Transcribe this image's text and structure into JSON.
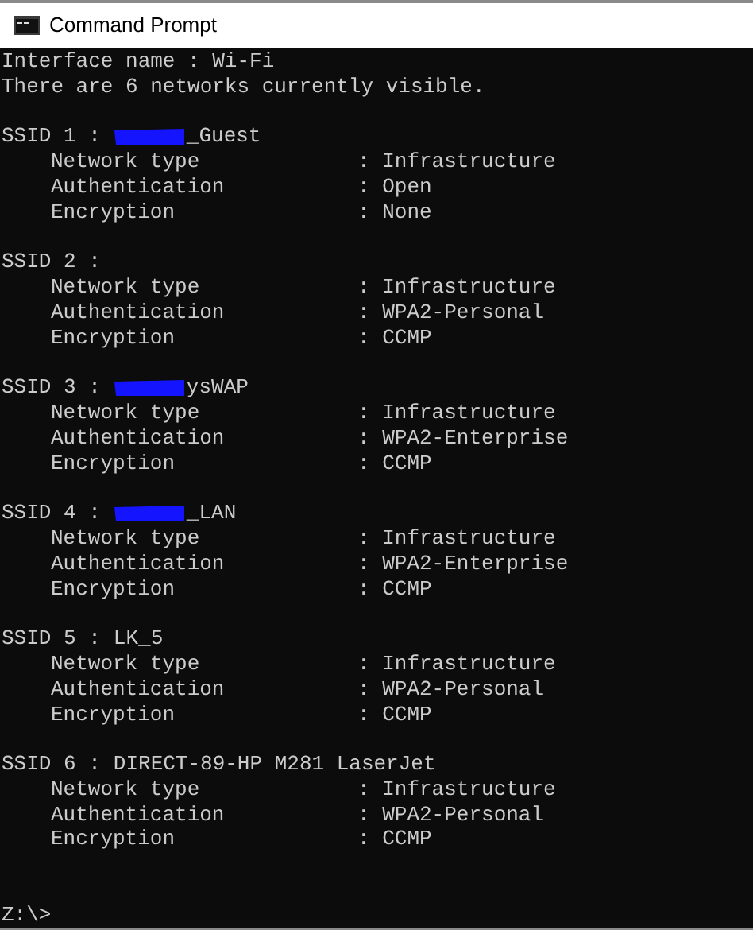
{
  "window": {
    "title": "Command Prompt"
  },
  "header": [
    "Interface name : Wi-Fi",
    "There are 6 networks currently visible."
  ],
  "networks": [
    {
      "heading": "SSID 1 :",
      "redacted": true,
      "name": "_Guest",
      "properties": [
        {
          "label": "Network type",
          "value": ": Infrastructure"
        },
        {
          "label": "Authentication",
          "value": ": Open"
        },
        {
          "label": "Encryption",
          "value": ": None"
        }
      ]
    },
    {
      "heading": "SSID 2 :",
      "redacted": false,
      "properties": [
        {
          "label": "Network type",
          "value": ": Infrastructure"
        },
        {
          "label": "Authentication",
          "value": ": WPA2-Personal"
        },
        {
          "label": "Encryption",
          "value": ": CCMP"
        }
      ]
    },
    {
      "heading": "SSID 3 :",
      "redacted": true,
      "name": "ysWAP",
      "properties": [
        {
          "label": "Network type",
          "value": ": Infrastructure"
        },
        {
          "label": "Authentication",
          "value": ": WPA2-Enterprise"
        },
        {
          "label": "Encryption",
          "value": ": CCMP"
        }
      ]
    },
    {
      "heading": "SSID 4 :",
      "redacted": true,
      "name": "_LAN",
      "properties": [
        {
          "label": "Network type",
          "value": ": Infrastructure"
        },
        {
          "label": "Authentication",
          "value": ": WPA2-Enterprise"
        },
        {
          "label": "Encryption",
          "value": ": CCMP"
        }
      ]
    },
    {
      "heading": "SSID 5 :",
      "redacted": false,
      "name": "LK_5",
      "properties": [
        {
          "label": "Network type",
          "value": ": Infrastructure"
        },
        {
          "label": "Authentication",
          "value": ": WPA2-Personal"
        },
        {
          "label": "Encryption",
          "value": ": CCMP"
        }
      ]
    },
    {
      "heading": "SSID 6 :",
      "redacted": false,
      "name": "DIRECT-89-HP M281 LaserJet",
      "properties": [
        {
          "label": "Network type",
          "value": ": Infrastructure"
        },
        {
          "label": "Authentication",
          "value": ": WPA2-Personal"
        },
        {
          "label": "Encryption",
          "value": ": CCMP"
        }
      ]
    }
  ],
  "prompt": "Z:\\>"
}
